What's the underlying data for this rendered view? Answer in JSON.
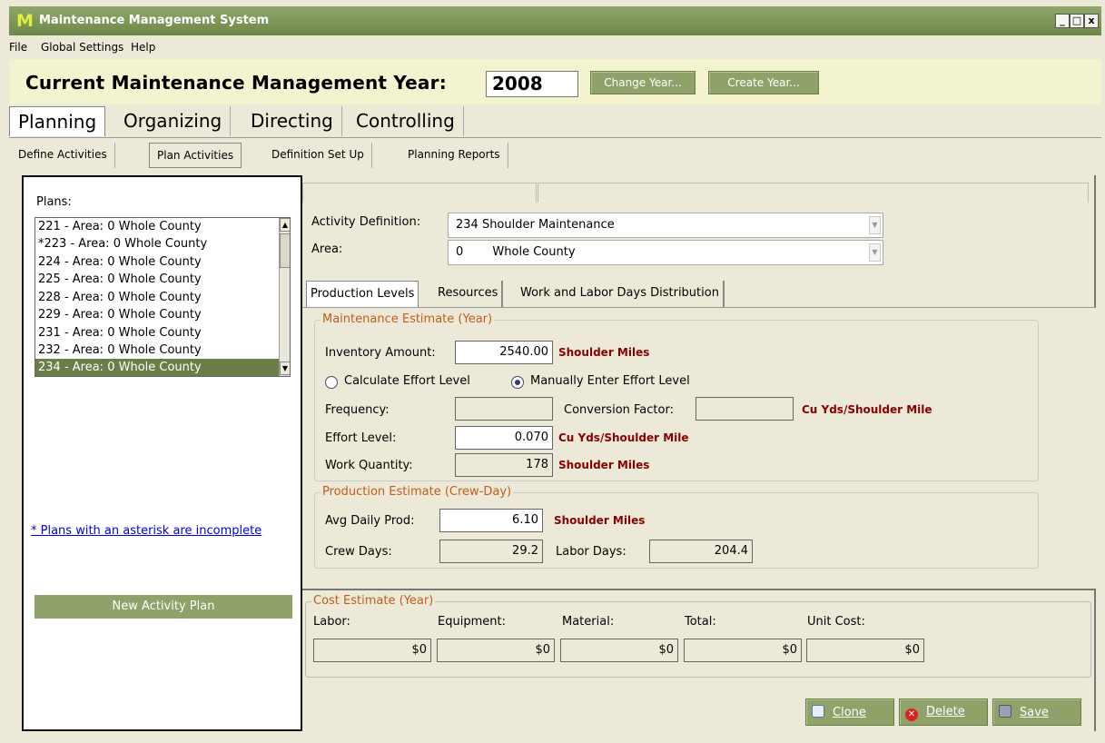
{
  "window": {
    "title": "Maintenance Management System",
    "logo_letter": "M",
    "controls": [
      "_",
      "□",
      "x"
    ]
  },
  "menu": [
    "File",
    "Global Settings",
    "Help"
  ],
  "year_bar": {
    "label": "Current Maintenance Management Year:",
    "year": "2008",
    "change_year": "Change Year...",
    "create_year": "Create Year..."
  },
  "main_tabs": [
    "Planning",
    "Organizing",
    "Directing",
    "Controlling"
  ],
  "sub_tabs": [
    "Define Activities",
    "Plan Activities",
    "Definition Set Up",
    "Planning Reports"
  ],
  "plans": {
    "label": "Plans:",
    "items": [
      "221 - Area: 0  Whole County",
      "*223 - Area: 0  Whole County",
      "224 - Area: 0  Whole County",
      "225 - Area: 0  Whole County",
      "228 - Area: 0  Whole County",
      "229 - Area: 0  Whole County",
      "231 - Area: 0  Whole County",
      "232 - Area: 0  Whole County",
      "234 - Area: 0  Whole County"
    ],
    "selected_index": 8,
    "asterisk_note": "* Plans with an asterisk are incomplete",
    "new_plan_button": "New Activity Plan"
  },
  "activity": {
    "definition_label": "Activity Definition:",
    "definition_value": "234  Shoulder Maintenance",
    "area_label": "Area:",
    "area_code": "0",
    "area_name": "Whole County"
  },
  "inner_tabs": [
    "Production Levels",
    "Resources",
    "Work and Labor Days Distribution"
  ],
  "maintenance_estimate": {
    "title": "Maintenance Estimate (Year)",
    "inventory_label": "Inventory Amount:",
    "inventory_value": "2540.00",
    "inventory_unit": "Shoulder Miles",
    "radio_calculate": "Calculate Effort Level",
    "radio_manual": "Manually Enter Effort Level",
    "frequency_label": "Frequency:",
    "frequency_value": "",
    "conversion_label": "Conversion Factor:",
    "conversion_value": "",
    "conversion_unit": "Cu Yds/Shoulder Mile",
    "effort_label": "Effort Level:",
    "effort_value": "0.070",
    "effort_unit": "Cu Yds/Shoulder Mile",
    "work_qty_label": "Work Quantity:",
    "work_qty_value": "178",
    "work_qty_unit": "Shoulder Miles"
  },
  "production_estimate": {
    "title": "Production Estimate (Crew-Day)",
    "avg_label": "Avg Daily Prod:",
    "avg_value": "6.10",
    "avg_unit": "Shoulder Miles",
    "crew_label": "Crew Days:",
    "crew_value": "29.2",
    "labor_label": "Labor Days:",
    "labor_value": "204.4"
  },
  "cost_estimate": {
    "title": "Cost Estimate (Year)",
    "labor_label": "Labor:",
    "labor_value": "$0",
    "equipment_label": "Equipment:",
    "equipment_value": "$0",
    "material_label": "Material:",
    "material_value": "$0",
    "total_label": "Total:",
    "total_value": "$0",
    "unit_cost_label": "Unit Cost:",
    "unit_cost_value": "$0"
  },
  "actions": {
    "clone": "Clone",
    "delete": "Delete",
    "save": "Save"
  },
  "colors": {
    "accent_green": "#8fa26a",
    "selected_green": "#6a7f47",
    "unit_red": "#880000",
    "group_title_orange": "#c45c1a",
    "year_bar_bg": "#f4f3cf"
  }
}
